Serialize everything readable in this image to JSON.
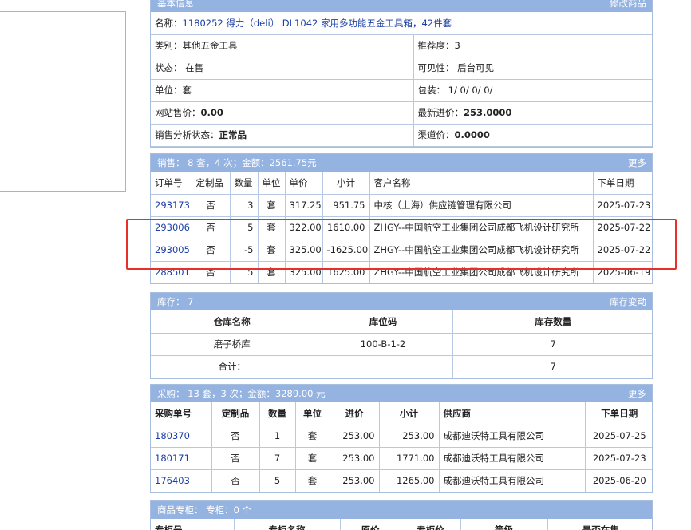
{
  "basic": {
    "title": "基本信息",
    "edit_link": "修改商品",
    "name_label": "名称：",
    "name_value": "1180252 得力（deli） DL1042 家用多功能五金工具箱，42件套",
    "category": "类别：其他五金工具",
    "recommend": "推荐度：3",
    "status": "状态：  在售",
    "visibility": "可见性：  后台可见",
    "unit": "单位：套",
    "packing": "包装：  1/ 0/ 0/ 0/",
    "site_price_label": "网站售价：",
    "site_price_value": "0.00",
    "latest_cost_label": "最新进价：",
    "latest_cost_value": "253.0000",
    "analysis_label": "销售分析状态：",
    "analysis_value": "正常品",
    "channel_price_label": "渠道价：",
    "channel_price_value": "0.0000"
  },
  "sales": {
    "title": "销售：  8 套，4 次；金额：2561.75元",
    "more": "更多",
    "headers": [
      "订单号",
      "定制品",
      "数量",
      "单位",
      "单价",
      "小计",
      "客户名称",
      "下单日期"
    ],
    "rows": [
      [
        "293173",
        "否",
        "3",
        "套",
        "317.25",
        "951.75",
        "中核（上海）供应链管理有限公司",
        "2025-07-23"
      ],
      [
        "293006",
        "否",
        "5",
        "套",
        "322.00",
        "1610.00",
        "ZHGY--中国航空工业集团公司成都飞机设计研究所",
        "2025-07-22"
      ],
      [
        "293005",
        "否",
        "-5",
        "套",
        "325.00",
        "-1625.00",
        "ZHGY--中国航空工业集团公司成都飞机设计研究所",
        "2025-07-22"
      ],
      [
        "288501",
        "否",
        "5",
        "套",
        "325.00",
        "1625.00",
        "ZHGY--中国航空工业集团公司成都飞机设计研究所",
        "2025-06-19"
      ]
    ]
  },
  "stock": {
    "title": "库存：  7",
    "link": "库存变动",
    "headers": [
      "仓库名称",
      "库位码",
      "库存数量"
    ],
    "rows": [
      [
        "磨子桥库",
        "100-B-1-2",
        "7"
      ]
    ],
    "total_label": "合计：",
    "total_value": "7"
  },
  "purchase": {
    "title": "采购：  13 套，3 次；金额：3289.00 元",
    "more": "更多",
    "headers": [
      "采购单号",
      "定制品",
      "数量",
      "单位",
      "进价",
      "小计",
      "供应商",
      "下单日期"
    ],
    "rows": [
      [
        "180370",
        "否",
        "1",
        "套",
        "253.00",
        "253.00",
        "成都迪沃特工具有限公司",
        "2025-07-25"
      ],
      [
        "180171",
        "否",
        "7",
        "套",
        "253.00",
        "1771.00",
        "成都迪沃特工具有限公司",
        "2025-07-23"
      ],
      [
        "176403",
        "否",
        "5",
        "套",
        "253.00",
        "1265.00",
        "成都迪沃特工具有限公司",
        "2025-06-20"
      ]
    ]
  },
  "counter": {
    "title": "商品专柜：  专柜：0 个",
    "headers": [
      "专柜号",
      "专柜名称",
      "原价",
      "专柜价",
      "等级",
      "是否在售"
    ]
  },
  "colors": {
    "header_bg": "#95b3e0",
    "link": "#1a3fa6",
    "highlight": "#e8302a"
  }
}
